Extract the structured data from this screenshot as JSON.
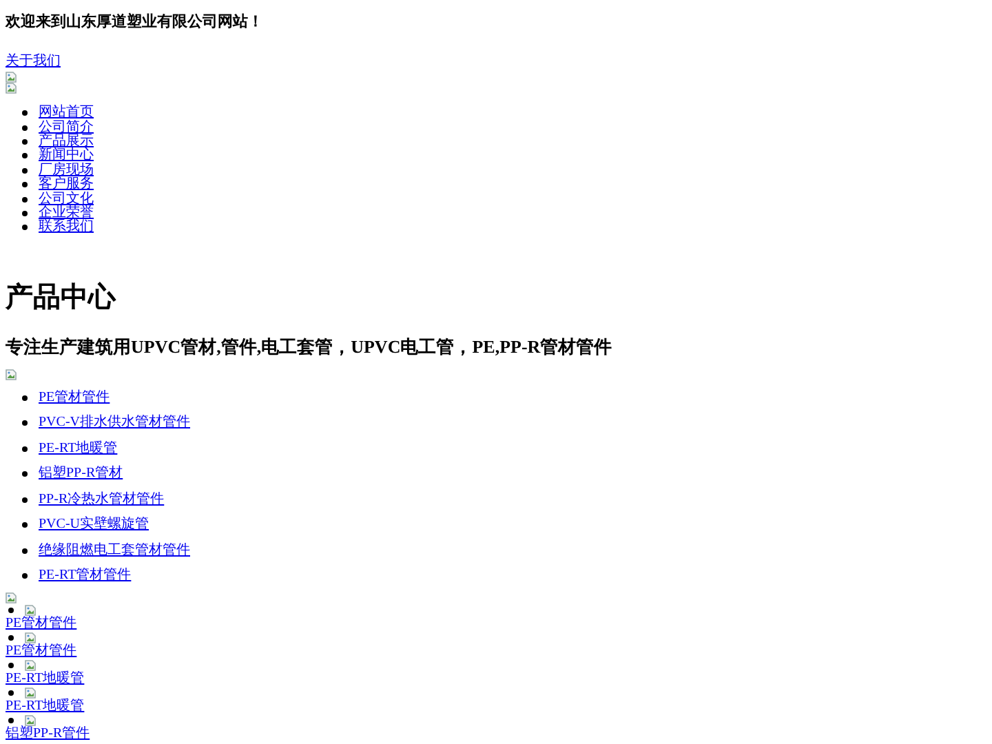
{
  "header": {
    "welcome": "欢迎来到山东厚道塑业有限公司网站！",
    "about_link": "关于我们"
  },
  "nav": {
    "items": [
      "网站首页",
      "公司简介",
      "产品展示",
      "新闻中心",
      "厂房现场",
      "客户服务",
      "公司文化",
      "企业荣誉",
      "联系我们"
    ]
  },
  "main": {
    "title": "产品中心",
    "subtitle": "专注生产建筑用UPVC管材,管件,电工套管，UPVC电工管，PE,PP-R管材管件",
    "categories": [
      "PE管材管件",
      "PVC-V排水供水管材管件",
      "PE-RT地暖管",
      "铝塑PP-R管材",
      "PP-R冷热水管材管件",
      "PVC-U实壁螺旋管",
      "绝缘阻燃电工套管材管件",
      "PE-RT管材管件"
    ]
  },
  "products": [
    "PE管材管件",
    "PE管材管件",
    "PE-RT地暖管",
    "PE-RT地暖管",
    "铝塑PP-R管件"
  ]
}
